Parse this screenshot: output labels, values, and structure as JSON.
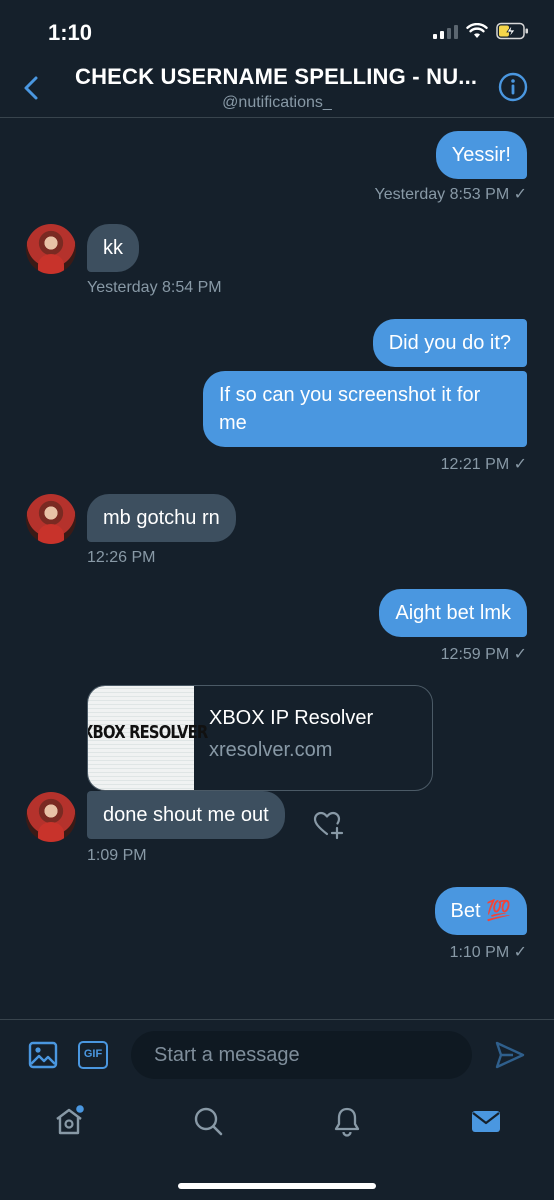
{
  "status_bar": {
    "time": "1:10"
  },
  "header": {
    "title": "CHECK USERNAME SPELLING - NU...",
    "handle": "@nutifications_"
  },
  "messages": [
    {
      "direction": "out",
      "text": "Yessir!",
      "meta": "Yesterday 8:53 PM ✓"
    },
    {
      "direction": "in",
      "text": "kk",
      "meta": "Yesterday 8:54 PM"
    },
    {
      "direction": "out",
      "text": "Did you do it?"
    },
    {
      "direction": "out",
      "text": "If so can you screenshot it for me",
      "meta": "12:21 PM ✓"
    },
    {
      "direction": "in",
      "text": "mb gotchu rn",
      "meta": "12:26 PM"
    },
    {
      "direction": "out",
      "text": "Aight bet lmk",
      "meta": "12:59 PM ✓"
    },
    {
      "direction": "in",
      "text": "done shout me out",
      "meta": "1:09 PM"
    },
    {
      "direction": "out",
      "text": "Bet 💯",
      "meta": "1:10 PM ✓"
    }
  ],
  "link_card": {
    "thumb_text": "XBOX RESOLVER",
    "title": "XBOX IP Resolver",
    "domain": "xresolver.com"
  },
  "composer": {
    "gif_label": "GIF",
    "placeholder": "Start a message"
  },
  "colors": {
    "background": "#15202b",
    "accent": "#4a97e0",
    "incoming_bubble": "#3d4f5f",
    "muted_text": "#8899a6"
  }
}
